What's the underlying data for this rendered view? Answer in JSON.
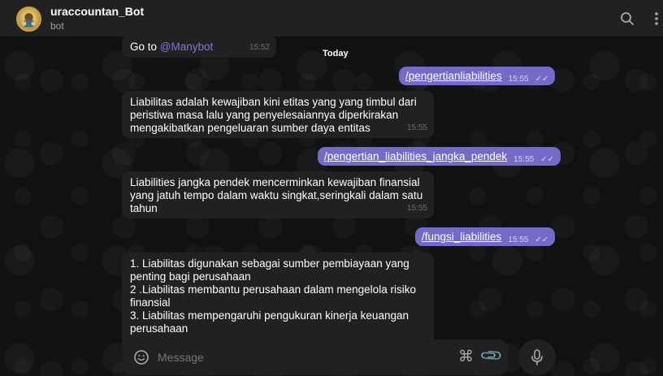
{
  "header": {
    "title": "uraccountan_Bot",
    "status": "bot",
    "icons": [
      "avatar",
      "search-icon",
      "more-vertical-icon"
    ]
  },
  "date_separator": "Today",
  "messages": [
    {
      "dir": "in",
      "text_prefix": "Go to ",
      "link": "@Manybot",
      "time": "15:52"
    },
    {
      "dir": "out",
      "text": "/pengertianliabilities",
      "time": "15:55"
    },
    {
      "dir": "in",
      "lines": [
        "Liabilitas adalah kewajiban kini etitas yang yang timbul dari",
        "peristiwa masa lalu yang penyelesaiannya diperkirakan",
        "mengakibatkan pengeluaran sumber daya entitas"
      ],
      "time": "15:55"
    },
    {
      "dir": "out",
      "text": "/pengertian_liabilities_jangka_pendek",
      "time": "15:55"
    },
    {
      "dir": "in",
      "lines": [
        "Liabilities jangka pendek mencerminkan kewajiban finansial",
        "yang jatuh tempo dalam waktu singkat,seringkali dalam satu",
        "tahun"
      ],
      "time": "15:55"
    },
    {
      "dir": "out",
      "text": "/fungsi_liabilities",
      "time": "15:55"
    },
    {
      "dir": "in",
      "lines": [
        "1. Liabilitas digunakan sebagai sumber pembiayaan yang",
        "penting bagi perusahaan",
        "2 .Liabilitas membantu perusahaan dalam mengelola risiko",
        "finansial",
        "3. Liabilitas mempengaruhi pengukuran kinerja keuangan",
        "perusahaan"
      ]
    }
  ],
  "composer": {
    "placeholder": "Message",
    "icons": [
      "emoji-icon",
      "command-icon",
      "attach-icon",
      "microphone-icon"
    ]
  },
  "colors": {
    "outgoing_bubble": "#766ac8",
    "incoming_bubble": "#212121",
    "link": "#8774e1",
    "header_bg": "#212121"
  }
}
